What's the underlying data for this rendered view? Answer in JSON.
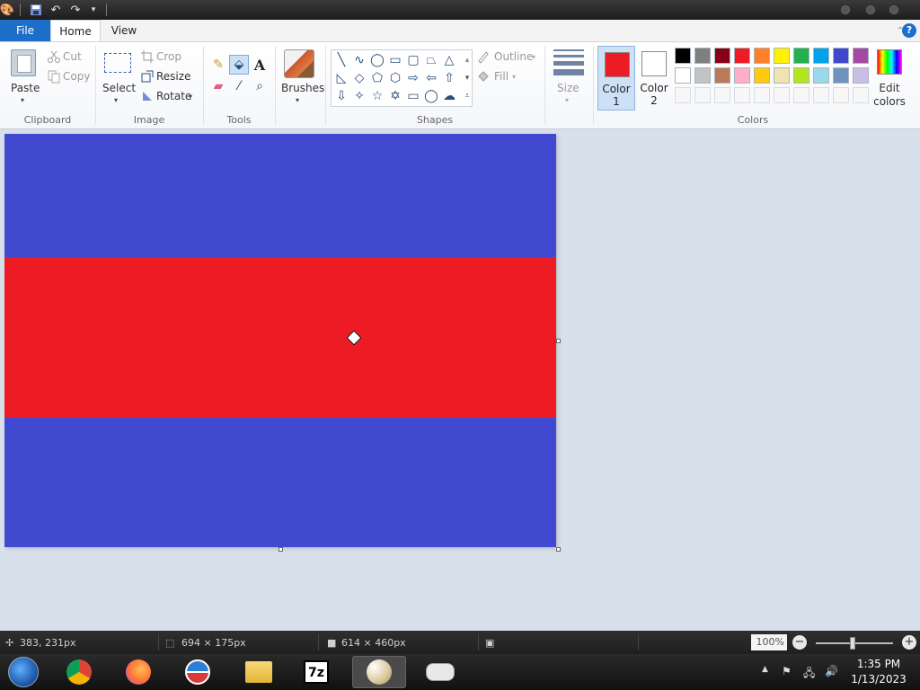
{
  "ribbon_tabs": {
    "file": "File",
    "home": "Home",
    "view": "View"
  },
  "clipboard": {
    "paste": "Paste",
    "cut": "Cut",
    "copy": "Copy",
    "label": "Clipboard"
  },
  "image": {
    "select": "Select",
    "crop": "Crop",
    "resize": "Resize",
    "rotate": "Rotate",
    "label": "Image"
  },
  "tools": {
    "label": "Tools"
  },
  "brushes": {
    "label": "Brushes"
  },
  "shapes": {
    "outline": "Outline",
    "fill": "Fill",
    "label": "Shapes"
  },
  "size": {
    "label": "Size"
  },
  "colors": {
    "color1_label": "Color 1",
    "color2_label": "Color 2",
    "edit_label": "Edit colors",
    "label": "Colors",
    "color1": "#ed1c24",
    "color2": "#ffffff",
    "palette_row1": [
      "#000000",
      "#7f7f7f",
      "#880015",
      "#ed1c24",
      "#ff7f27",
      "#fff200",
      "#22b14c",
      "#00a2e8",
      "#3f48cc",
      "#a349a4"
    ],
    "palette_row2": [
      "#ffffff",
      "#c3c3c3",
      "#b97a57",
      "#ffaec9",
      "#ffc90e",
      "#efe4b0",
      "#b5e61d",
      "#99d9ea",
      "#7092be",
      "#c8bfe7"
    ]
  },
  "canvas": {
    "band_top": "#4049cf",
    "band_middle": "#ed1c24",
    "band_bottom": "#4049cf"
  },
  "status": {
    "cursor_pos": "383, 231px",
    "selection_size": "694 × 175px",
    "image_size": "614 × 460px",
    "zoom": "100%"
  },
  "clock": {
    "time": "1:35 PM",
    "date": "1/13/2023"
  }
}
